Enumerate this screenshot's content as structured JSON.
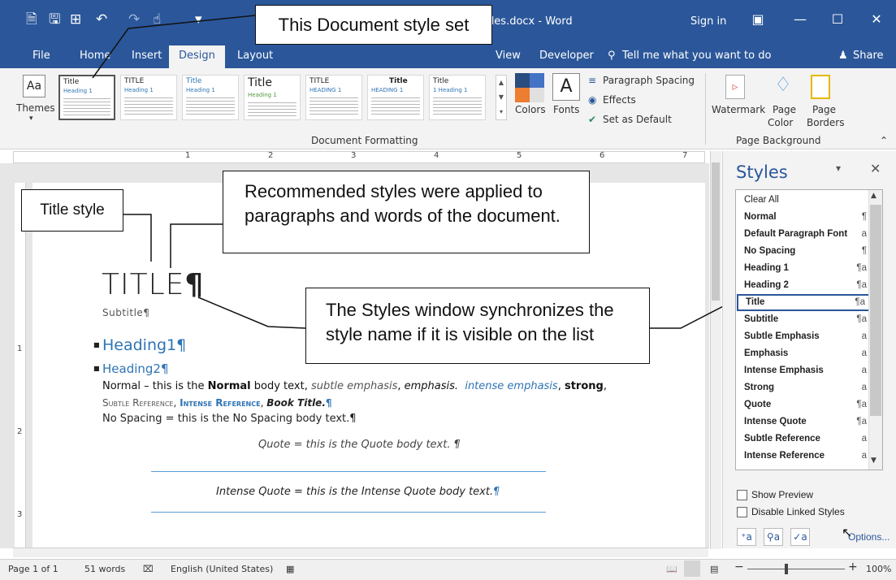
{
  "titlebar": {
    "doc_title": "yles.docx - Word",
    "sign_in": "Sign in",
    "icons": [
      "new-document-icon",
      "save-icon",
      "save-as-icon",
      "undo-icon",
      "redo-icon",
      "touch-mode-icon",
      "qat-dropdown-icon",
      "ribbon-options-icon",
      "minimize-icon",
      "maximize-icon",
      "close-icon"
    ]
  },
  "tabs": [
    {
      "label": "File"
    },
    {
      "label": "Home"
    },
    {
      "label": "Insert"
    },
    {
      "label": "Design"
    },
    {
      "label": "Layout"
    },
    {
      "label": "View"
    },
    {
      "label": "Developer"
    }
  ],
  "tell_me": "Tell me what you want to do",
  "share": "Share",
  "ribbon": {
    "themes": "Themes",
    "gallery": [
      {
        "title": "Title",
        "heading": "Heading 1"
      },
      {
        "title": "TITLE",
        "heading": "Heading 1"
      },
      {
        "title": "Title",
        "heading": "Heading 1"
      },
      {
        "title": "Title",
        "heading": "Heading 1"
      },
      {
        "title": "TITLE",
        "heading": "HEADING 1"
      },
      {
        "title": "Title",
        "heading": "HEADING 1"
      },
      {
        "title": "Title",
        "heading": "1 Heading 1"
      }
    ],
    "document_formatting": "Document Formatting",
    "colors": "Colors",
    "fonts": "Fonts",
    "paragraph_spacing": "Paragraph Spacing",
    "effects": "Effects",
    "set_as_default": "Set as Default",
    "watermark": "Watermark",
    "page_color_line1": "Page",
    "page_color_line2": "Color",
    "page_borders_line1": "Page",
    "page_borders_line2": "Borders",
    "page_background": "Page Background"
  },
  "ruler": [
    "1",
    "2",
    "3",
    "4",
    "5",
    "6",
    "7"
  ],
  "vruler": [
    "1",
    "2",
    "3"
  ],
  "document": {
    "title": "TITLE",
    "pilcrow": "¶",
    "subtitle": "Subtitle¶",
    "heading1": "Heading1¶",
    "heading2": "Heading2¶",
    "normal_a": "Normal – this is the ",
    "normal_b": "Normal",
    "normal_c": " body text, ",
    "subtle_emphasis": "subtle emphasis",
    "comma1": ", ",
    "emphasis": "emphasis.",
    "intense_emphasis": "intense emphasis",
    "comma2": ", ",
    "strong": "strong",
    "comma3": ",",
    "subtle_reference": "Subtle Reference",
    "intense_reference": "Intense Reference",
    "book_title": "Book Title.",
    "no_spacing": "No Spacing = this is the No Spacing body text.¶",
    "quote": "Quote = this is the Quote body text. ¶",
    "intense_quote": "Intense Quote = this is the Intense Quote body text.",
    "intense_quote_pilcrow": "¶"
  },
  "callouts": {
    "document_style_set": "This Document style set",
    "title_style": "Title style",
    "recommended_line1": "Recommended styles were applied to",
    "recommended_line2": "paragraphs and words of the document.",
    "sync_line1": "The Styles window synchronizes the",
    "sync_line2": "style name if it is visible on the list"
  },
  "styles_pane": {
    "title": "Styles",
    "items": [
      {
        "name": "Clear All",
        "glyph": ""
      },
      {
        "name": "Normal",
        "glyph": "¶"
      },
      {
        "name": "Default Paragraph Font",
        "glyph": "a"
      },
      {
        "name": "No Spacing",
        "glyph": "¶"
      },
      {
        "name": "Heading 1",
        "glyph": "¶a"
      },
      {
        "name": "Heading 2",
        "glyph": "¶a"
      },
      {
        "name": "Title",
        "glyph": "¶a"
      },
      {
        "name": "Subtitle",
        "glyph": "¶a"
      },
      {
        "name": "Subtle Emphasis",
        "glyph": "a"
      },
      {
        "name": "Emphasis",
        "glyph": "a"
      },
      {
        "name": "Intense Emphasis",
        "glyph": "a"
      },
      {
        "name": "Strong",
        "glyph": "a"
      },
      {
        "name": "Quote",
        "glyph": "¶a"
      },
      {
        "name": "Intense Quote",
        "glyph": "¶a"
      },
      {
        "name": "Subtle Reference",
        "glyph": "a"
      },
      {
        "name": "Intense Reference",
        "glyph": "a"
      }
    ],
    "selected": "Title",
    "show_preview": "Show Preview",
    "disable_linked": "Disable Linked Styles",
    "options": "Options..."
  },
  "status": {
    "page": "Page 1 of 1",
    "words": "51 words",
    "language": "English (United States)",
    "zoom": "100%"
  },
  "colors": {
    "accent": "#2b579a",
    "heading": "#2e74b5"
  }
}
